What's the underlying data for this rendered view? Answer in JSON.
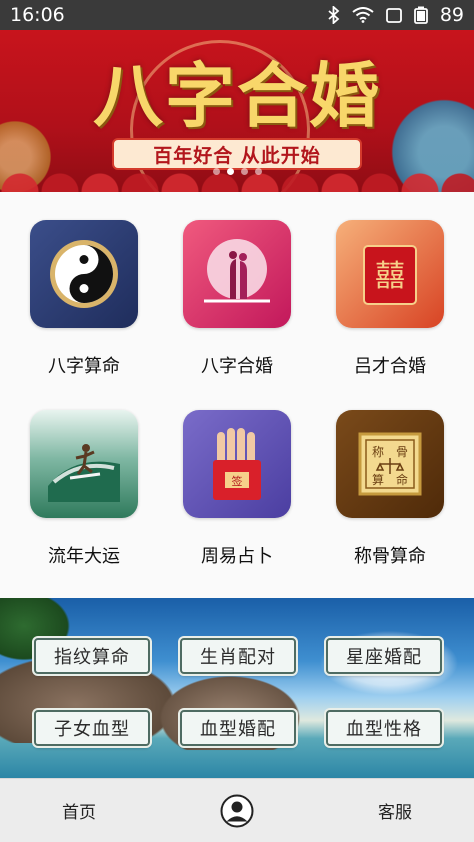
{
  "status_bar": {
    "time": "16:06",
    "battery_level": "89",
    "icons": [
      "bluetooth-icon",
      "wifi-icon",
      "tablet-icon",
      "battery-icon"
    ]
  },
  "banner": {
    "title": "八字合婚",
    "subtitle": "百年好合 从此开始",
    "slide_count": 4,
    "active_slide": 2
  },
  "features": [
    {
      "label": "八字算命",
      "icon": "yin-yang-icon"
    },
    {
      "label": "八字合婚",
      "icon": "couple-moon-icon"
    },
    {
      "label": "吕才合婚",
      "icon": "double-happiness-icon"
    },
    {
      "label": "流年大运",
      "icon": "surfer-icon"
    },
    {
      "label": "周易占卜",
      "icon": "hand-envelope-icon"
    },
    {
      "label": "称骨算命",
      "icon": "scale-seal-icon"
    }
  ],
  "quick_links": [
    {
      "label": "指纹算命"
    },
    {
      "label": "生肖配对"
    },
    {
      "label": "星座婚配"
    },
    {
      "label": "子女血型"
    },
    {
      "label": "血型婚配"
    },
    {
      "label": "血型性格"
    }
  ],
  "bottom_nav": {
    "home": "首页",
    "profile_icon": "user-avatar-icon",
    "service": "客服"
  },
  "colors": {
    "banner_red": "#c8141c",
    "banner_gold": "#f8d76a",
    "status_bar": "#3a3a3a",
    "bottom_nav": "#ececec"
  }
}
